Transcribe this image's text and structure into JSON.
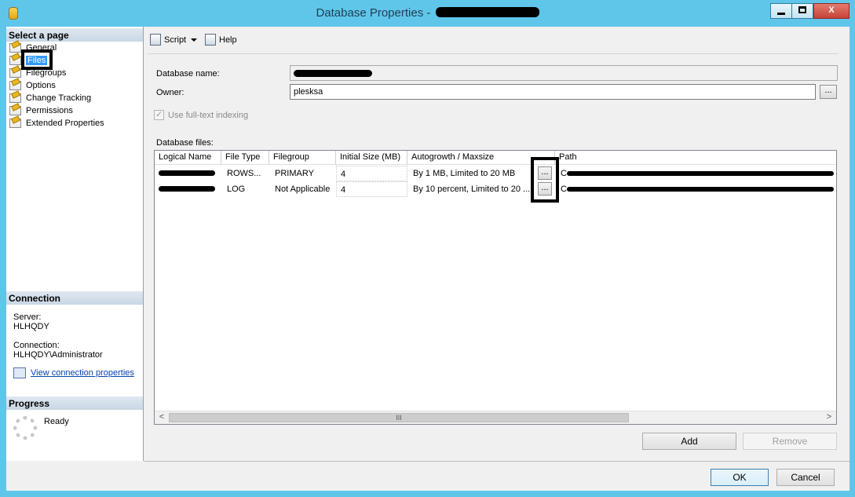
{
  "window": {
    "title": "Database Properties -",
    "minimize_label": "",
    "maximize_label": "",
    "close_label": "X"
  },
  "left_panel": {
    "select_page_header": "Select a page",
    "pages": [
      {
        "label": "General"
      },
      {
        "label": "Files"
      },
      {
        "label": "Filegroups"
      },
      {
        "label": "Options"
      },
      {
        "label": "Change Tracking"
      },
      {
        "label": "Permissions"
      },
      {
        "label": "Extended Properties"
      }
    ],
    "connection": {
      "header": "Connection",
      "server_label": "Server:",
      "server_value": "HLHQDY",
      "connection_label": "Connection:",
      "connection_value": "HLHQDY\\Administrator",
      "link_text": "View connection properties"
    },
    "progress": {
      "header": "Progress",
      "status": "Ready"
    }
  },
  "toolbar": {
    "script_label": "Script",
    "help_label": "Help"
  },
  "form": {
    "database_name_label": "Database name:",
    "owner_label": "Owner:",
    "owner_value": "plesksa",
    "browse_label": "...",
    "fulltext_label": "Use full-text indexing",
    "database_files_label": "Database files:"
  },
  "grid": {
    "columns": [
      "Logical Name",
      "File Type",
      "Filegroup",
      "Initial Size (MB)",
      "Autogrowth / Maxsize",
      "Path"
    ],
    "rows": [
      {
        "file_type": "ROWS...",
        "filegroup": "PRIMARY",
        "initial_size": "4",
        "autogrowth": "By 1 MB, Limited to 20 MB",
        "path_prefix": "C"
      },
      {
        "file_type": "LOG",
        "filegroup": "Not Applicable",
        "initial_size": "4",
        "autogrowth": "By 10 percent, Limited to 20 ...",
        "path_prefix": "C"
      }
    ],
    "cell_button_label": "...",
    "scroll_thumb_label": "III",
    "scroll_left": "<",
    "scroll_right": ">"
  },
  "actions": {
    "add_label": "Add",
    "remove_label": "Remove",
    "ok_label": "OK",
    "cancel_label": "Cancel"
  }
}
